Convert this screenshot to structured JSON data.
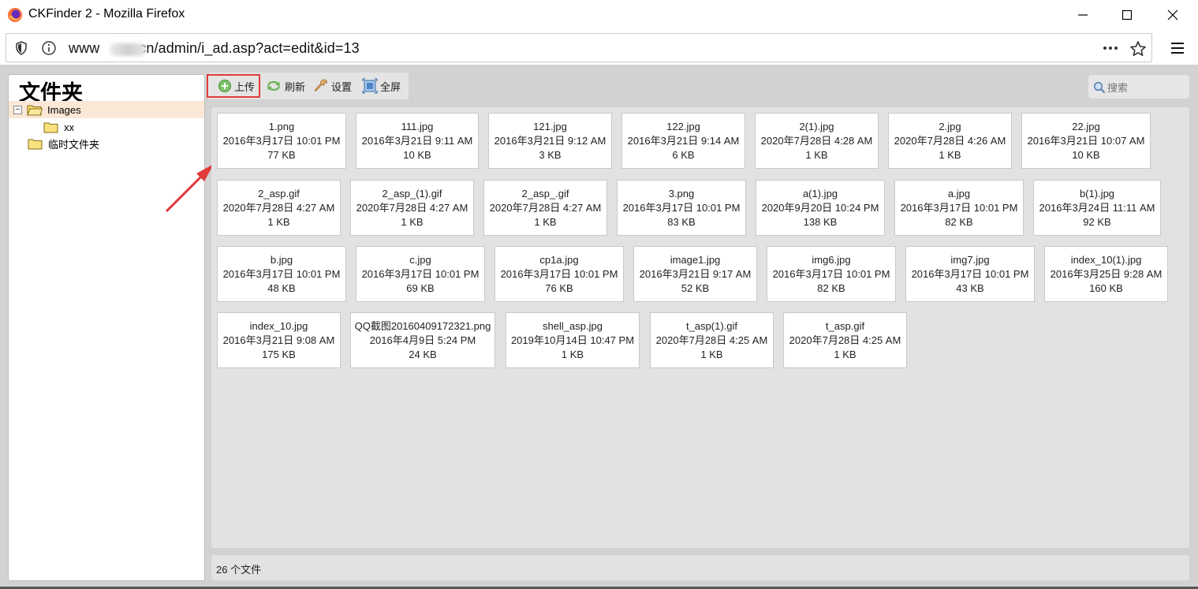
{
  "window": {
    "title": "CKFinder 2 - Mozilla Firefox"
  },
  "urlbar": {
    "url_prefix": "www",
    "url_suffix": "cn/admin/i_ad.asp?act=edit&id=13"
  },
  "sidebar": {
    "title": "文件夹",
    "tree": [
      {
        "label": "Images",
        "toggle": "−",
        "selected": true
      },
      {
        "label": "xx"
      },
      {
        "label": "临时文件夹"
      }
    ]
  },
  "toolbar": {
    "upload": "上传",
    "refresh": "刷新",
    "settings": "设置",
    "fullscreen": "全屏"
  },
  "search": {
    "placeholder": "搜索"
  },
  "files": [
    {
      "name": "1.png",
      "date": "2016年3月17日 10:01 PM",
      "size": "77 KB"
    },
    {
      "name": "111.jpg",
      "date": "2016年3月21日 9:11 AM",
      "size": "10 KB"
    },
    {
      "name": "121.jpg",
      "date": "2016年3月21日 9:12 AM",
      "size": "3 KB"
    },
    {
      "name": "122.jpg",
      "date": "2016年3月21日 9:14 AM",
      "size": "6 KB"
    },
    {
      "name": "2(1).jpg",
      "date": "2020年7月28日 4:28 AM",
      "size": "1 KB"
    },
    {
      "name": "2.jpg",
      "date": "2020年7月28日 4:26 AM",
      "size": "1 KB"
    },
    {
      "name": "22.jpg",
      "date": "2016年3月21日 10:07 AM",
      "size": "10 KB"
    },
    {
      "name": "2_asp.gif",
      "date": "2020年7月28日 4:27 AM",
      "size": "1 KB"
    },
    {
      "name": "2_asp_(1).gif",
      "date": "2020年7月28日 4:27 AM",
      "size": "1 KB"
    },
    {
      "name": "2_asp_.gif",
      "date": "2020年7月28日 4:27 AM",
      "size": "1 KB"
    },
    {
      "name": "3.png",
      "date": "2016年3月17日 10:01 PM",
      "size": "83 KB"
    },
    {
      "name": "a(1).jpg",
      "date": "2020年9月20日 10:24 PM",
      "size": "138 KB"
    },
    {
      "name": "a.jpg",
      "date": "2016年3月17日 10:01 PM",
      "size": "82 KB"
    },
    {
      "name": "b(1).jpg",
      "date": "2016年3月24日 11:11 AM",
      "size": "92 KB"
    },
    {
      "name": "b.jpg",
      "date": "2016年3月17日 10:01 PM",
      "size": "48 KB"
    },
    {
      "name": "c.jpg",
      "date": "2016年3月17日 10:01 PM",
      "size": "69 KB"
    },
    {
      "name": "cp1a.jpg",
      "date": "2016年3月17日 10:01 PM",
      "size": "76 KB"
    },
    {
      "name": "image1.jpg",
      "date": "2016年3月21日 9:17 AM",
      "size": "52 KB"
    },
    {
      "name": "img6.jpg",
      "date": "2016年3月17日 10:01 PM",
      "size": "82 KB"
    },
    {
      "name": "img7.jpg",
      "date": "2016年3月17日 10:01 PM",
      "size": "43 KB"
    },
    {
      "name": "index_10(1).jpg",
      "date": "2016年3月25日 9:28 AM",
      "size": "160 KB"
    },
    {
      "name": "index_10.jpg",
      "date": "2016年3月21日 9:08 AM",
      "size": "175 KB"
    },
    {
      "name": "QQ截图20160409172321.png",
      "date": "2016年4月9日 5:24 PM",
      "size": "24 KB"
    },
    {
      "name": "shell_asp.jpg",
      "date": "2019年10月14日 10:47 PM",
      "size": "1 KB"
    },
    {
      "name": "t_asp(1).gif",
      "date": "2020年7月28日 4:25 AM",
      "size": "1 KB"
    },
    {
      "name": "t_asp.gif",
      "date": "2020年7月28日 4:25 AM",
      "size": "1 KB"
    }
  ],
  "status": {
    "count_text": "26 个文件"
  },
  "colors": {
    "highlight": "#e03a3a",
    "selected_row": "#fbe7d6",
    "panel_bg": "#d2d2d2"
  }
}
